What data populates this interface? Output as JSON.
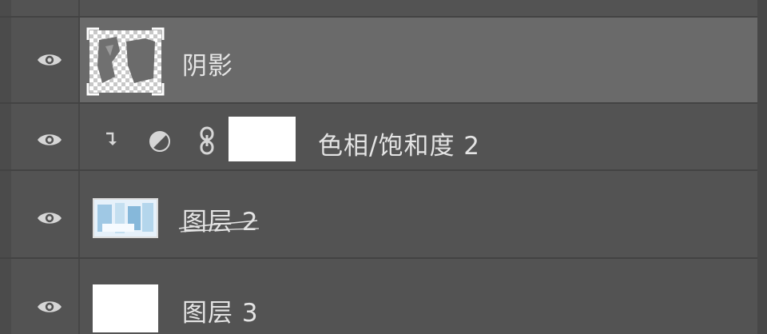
{
  "layers_panel": {
    "layers": [
      {
        "name": "阴影",
        "visible": true,
        "selected": true,
        "thumbnail": "transparent-shadow-mask"
      },
      {
        "name": "色相/饱和度 2",
        "visible": true,
        "selected": false,
        "clipped": true,
        "adjustment": "hue-saturation",
        "linked_mask": true
      },
      {
        "name": "图层 2",
        "visible": true,
        "selected": false,
        "thumbnail": "blue-image"
      },
      {
        "name": "图层 3",
        "visible": true,
        "selected": false,
        "thumbnail": "white"
      }
    ]
  },
  "colors": {
    "panel_bg": "#535353",
    "selected_row_bg": "#6a6a6a",
    "divider": "#434343",
    "text": "#e4e4e4",
    "icon": "#d6d6d6"
  }
}
